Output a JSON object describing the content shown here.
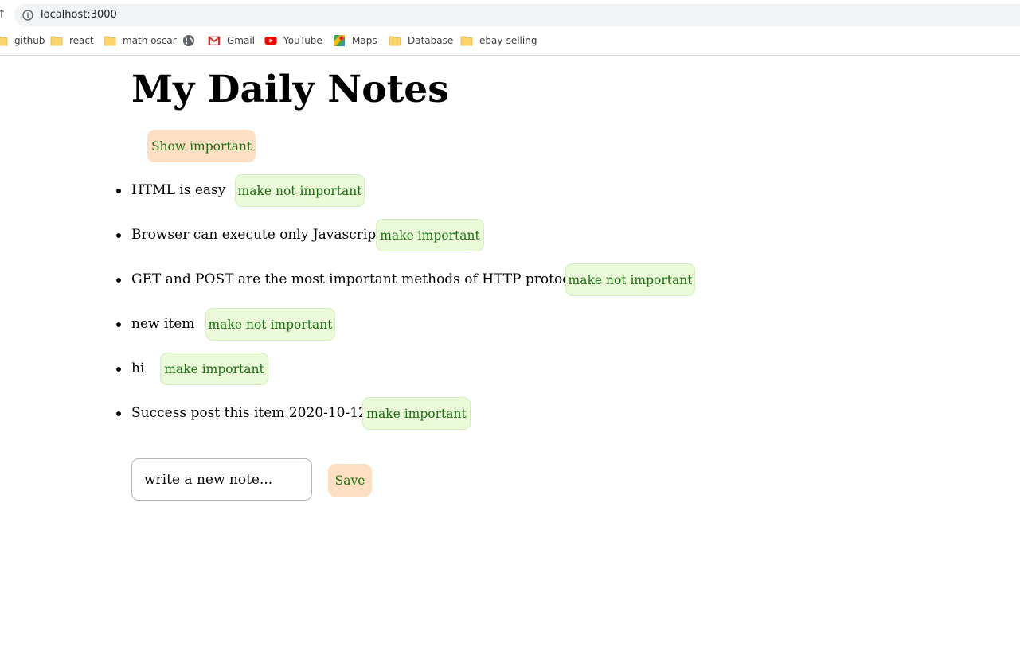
{
  "browser": {
    "url": "localhost:3000",
    "bookmarks": [
      {
        "label": "github",
        "icon": "folder-icon"
      },
      {
        "label": "react",
        "icon": "folder-icon"
      },
      {
        "label": "math oscar",
        "icon": "folder-icon"
      },
      {
        "label": "",
        "icon": "globe-icon"
      },
      {
        "label": "Gmail",
        "icon": "gmail-icon"
      },
      {
        "label": "YouTube",
        "icon": "youtube-icon"
      },
      {
        "label": "Maps",
        "icon": "maps-icon"
      },
      {
        "label": "Database",
        "icon": "folder-icon"
      },
      {
        "label": "ebay-selling",
        "icon": "folder-icon"
      }
    ]
  },
  "app": {
    "title": "My Daily Notes",
    "toggle_label": "Show important",
    "notes": [
      {
        "content": "HTML is easy",
        "action": "make not important"
      },
      {
        "content": "Browser can execute only Javascript",
        "action": "make important"
      },
      {
        "content": "GET and POST are the most important methods of HTTP protocol",
        "action": "make not important"
      },
      {
        "content": "new item",
        "action": "make not important"
      },
      {
        "content": "hi",
        "action": "make important"
      },
      {
        "content": "Success post this item 2020-10-12",
        "action": "make important"
      }
    ],
    "form": {
      "placeholder": "write a new note...",
      "save_label": "Save"
    }
  },
  "colors": {
    "button_orange": "#fde0c3",
    "button_green": "#ebfbd9",
    "button_text": "#1b6e12"
  }
}
